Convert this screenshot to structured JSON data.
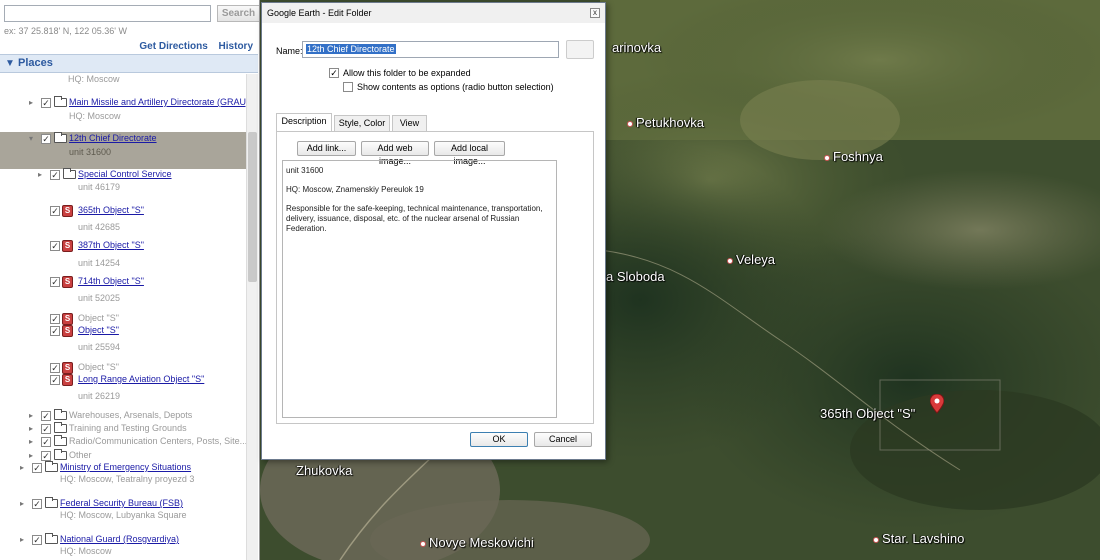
{
  "sidebar": {
    "search_button": "Search",
    "coords": "ex: 37 25.818' N, 122 05.36' W",
    "get_directions": "Get Directions",
    "history": "History",
    "places_title": "Places",
    "items": [
      {
        "sub": "HQ: Moscow"
      },
      {
        "label": "Main Missile and Artillery Directorate (GRAU)",
        "sub": "HQ: Moscow"
      },
      {
        "label": "12th Chief Directorate",
        "sub": "unit 31600"
      },
      {
        "label": "Special Control Service",
        "sub": "unit 46179"
      },
      {
        "label": "365th Object \"S\"",
        "sub": "unit 42685"
      },
      {
        "label": "387th Object \"S\"",
        "sub": "unit 14254"
      },
      {
        "label": "714th Object \"S\"",
        "sub": "unit 52025"
      },
      {
        "label_grey": "Object \"S\"",
        "label": "Object \"S\"",
        "sub": "unit 25594"
      },
      {
        "label_grey": "Object \"S\"",
        "label": "Long Range Aviation Object \"S\"",
        "sub": "unit 26219"
      },
      {
        "label": "Warehouses, Arsenals, Depots"
      },
      {
        "label": "Training and Testing Grounds"
      },
      {
        "label": "Radio/Communication Centers, Posts, Site..."
      },
      {
        "label": "Other"
      },
      {
        "label": "Ministry of Emergency Situations",
        "sub": "HQ: Moscow, Teatralny proyezd 3"
      },
      {
        "label": "Federal Security Bureau (FSB)",
        "sub": "HQ: Moscow, Lubyanka Square"
      },
      {
        "label": "National Guard (Rosgvardiya)",
        "sub": "HQ: Moscow"
      }
    ]
  },
  "map": {
    "labels": [
      "arinovka",
      "Petukhovka",
      "Foshnya",
      "Veleya",
      "a Sloboda",
      "365th Object \"S\"",
      "Zhukovka",
      "Novye Meskovichi",
      "Star. Lavshino"
    ]
  },
  "dialog": {
    "title": "Google Earth - Edit Folder",
    "close": "x",
    "name_label": "Name:",
    "name_value": "12th Chief Directorate",
    "allow_expand": "Allow this folder to be expanded",
    "radio_option": "Show contents as options (radio button selection)",
    "tabs": [
      "Description",
      "Style, Color",
      "View"
    ],
    "add_link": "Add link...",
    "add_web_image": "Add web image...",
    "add_local_image": "Add local image...",
    "description": [
      "unit 31600",
      "HQ: Moscow, Znamenskiy Pereulok 19",
      "Responsible for the safe-keeping, technical maintenance, transportation, delivery, issuance, disposal, etc. of the nuclear arsenal of Russian Federation."
    ],
    "ok": "OK",
    "cancel": "Cancel"
  }
}
